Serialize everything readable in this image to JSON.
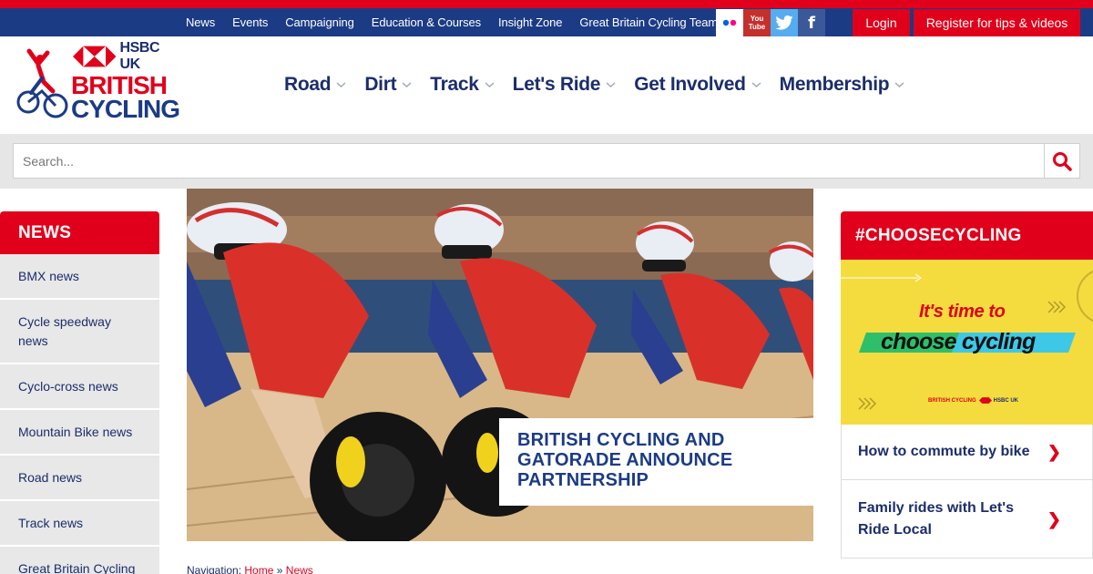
{
  "utility_nav": [
    "News",
    "Events",
    "Campaigning",
    "Education & Courses",
    "Insight Zone",
    "Great Britain Cycling Team"
  ],
  "social": {
    "youtube_line1": "You",
    "youtube_line2": "Tube",
    "facebook": "f"
  },
  "auth": {
    "login": "Login",
    "register": "Register for tips & videos"
  },
  "logo": {
    "sponsor": "HSBC UK",
    "line1": "BRITISH",
    "line2": "CYCLING"
  },
  "main_nav": [
    "Road",
    "Dirt",
    "Track",
    "Let's Ride",
    "Get Involved",
    "Membership"
  ],
  "search": {
    "placeholder": "Search..."
  },
  "sidebar": {
    "title": "NEWS",
    "items": [
      "BMX news",
      "Cycle speedway news",
      "Cyclo-cross news",
      "Mountain Bike news",
      "Road news",
      "Track news",
      "Great Britain Cycling"
    ]
  },
  "hero": {
    "title": "BRITISH CYCLING AND GATORADE ANNOUNCE PARTNERSHIP"
  },
  "breadcrumb": {
    "label": "Navigation:",
    "home": "Home",
    "sep": "»",
    "current": "News"
  },
  "right": {
    "title": "#CHOOSECYCLING",
    "promo": {
      "line1": "It's time to",
      "line2": "choose cycling",
      "brand": "BRITISH CYCLING",
      "sponsor": "HSBC UK"
    },
    "links": [
      {
        "label": "How to commute by bike",
        "arrow": "❯"
      },
      {
        "label": "Family rides with Let's Ride Local",
        "arrow": "❯"
      }
    ]
  },
  "colors": {
    "red": "#e0001b",
    "navy": "#1c3b85",
    "text_navy": "#1b2d6b",
    "promo_yellow": "#f4dc3e"
  }
}
